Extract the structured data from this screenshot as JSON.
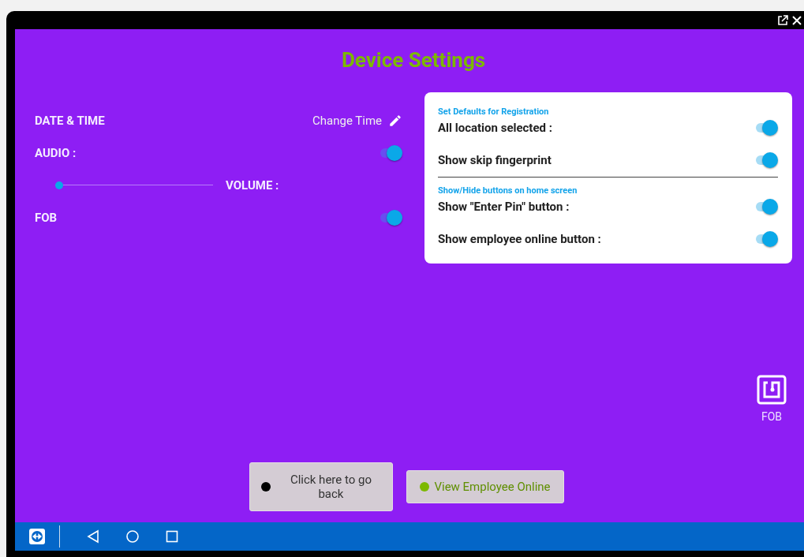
{
  "title": "Device Settings",
  "settings": [
    {
      "kind": "action",
      "label": "DATE & TIME",
      "action": "Change Time"
    },
    {
      "kind": "toggle",
      "label": "AUDIO :",
      "on": true
    },
    {
      "kind": "slider",
      "label": "VOLUME :",
      "level": 0.0
    },
    {
      "kind": "toggle",
      "label": "FOB",
      "on": true
    }
  ],
  "defaults_card": {
    "sections": [
      {
        "heading": "Set Defaults for Registration",
        "items": [
          {
            "label": "All location selected :",
            "on": true
          },
          {
            "label": "Show skip fingerprint",
            "on": true
          }
        ]
      },
      {
        "heading": "Show/Hide buttons on home screen",
        "items": [
          {
            "label": "Show \"Enter Pin\" button :",
            "on": true
          },
          {
            "label": "Show employee online button :",
            "on": true
          }
        ]
      }
    ]
  },
  "fob_shortcut": {
    "label": "FOB"
  },
  "buttons": [
    {
      "label": "Click here to go back",
      "color": "#000000"
    },
    {
      "label": "View Employee Online",
      "color": "#7cb800"
    }
  ]
}
